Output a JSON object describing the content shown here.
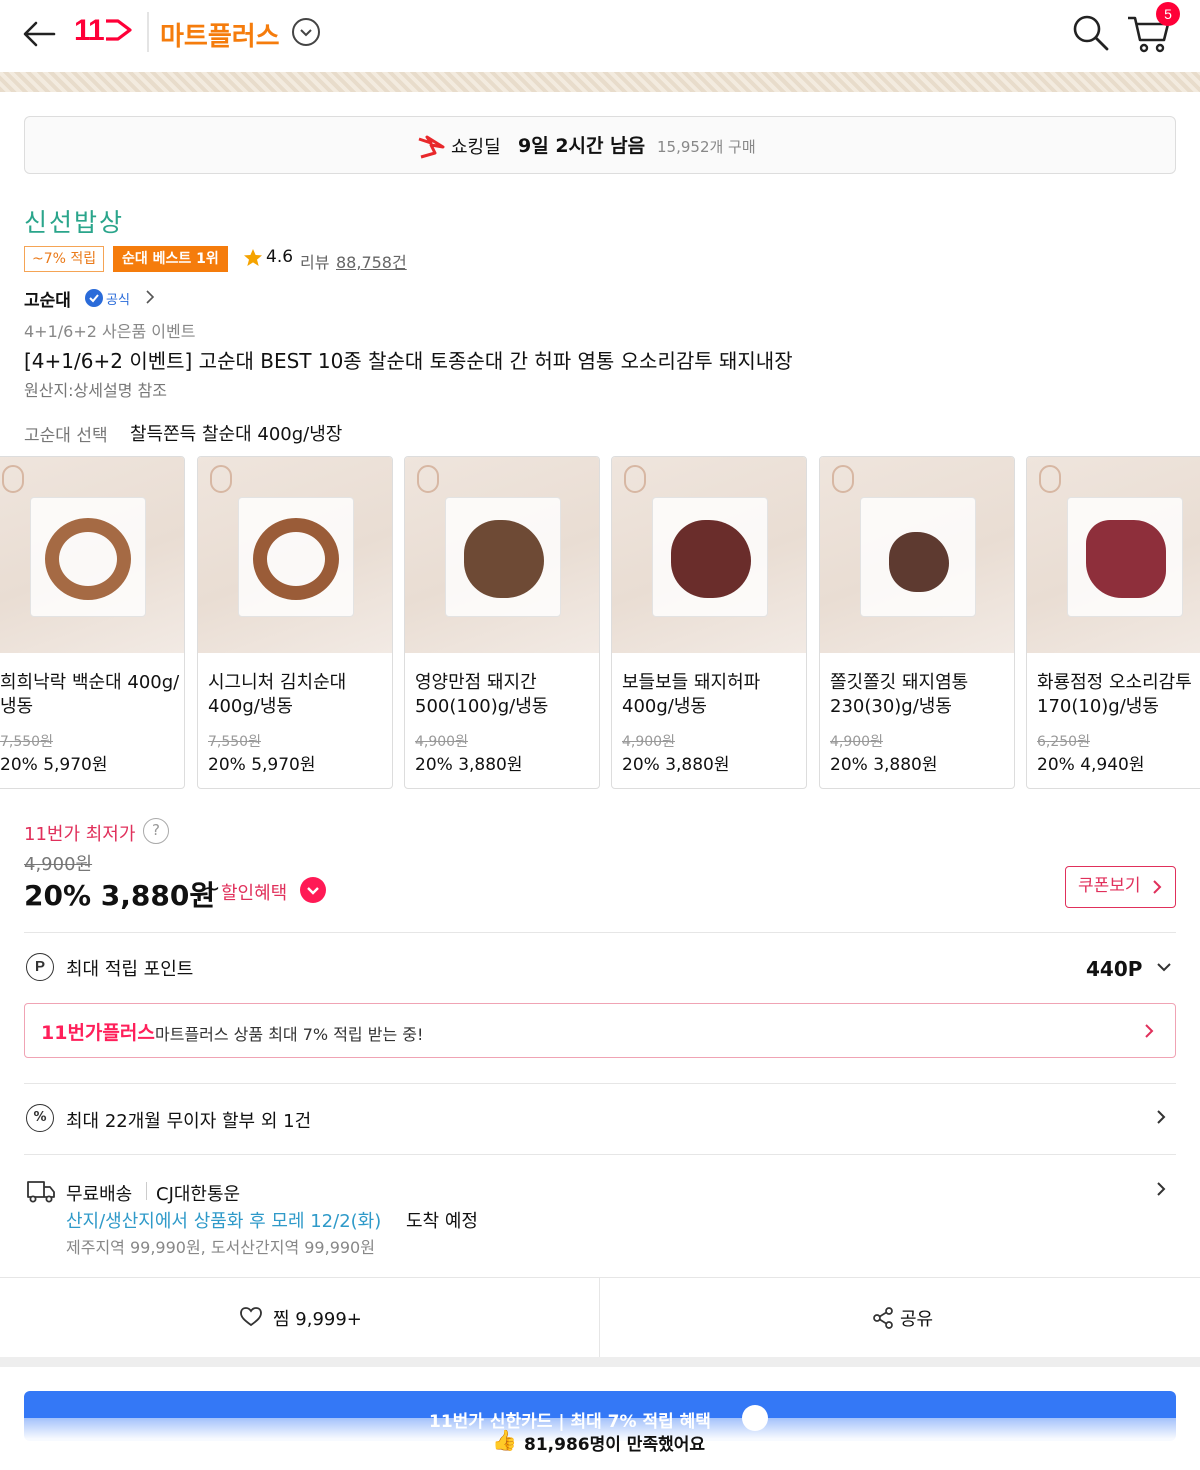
{
  "header": {
    "logo": "11",
    "store_title": "마트플러스",
    "cart_count": "5"
  },
  "deal": {
    "label": "쇼킹딜",
    "time_left": "9일 2시간 남음",
    "purchase_count": "15,952개 구매"
  },
  "product": {
    "brand": "신선밥상",
    "point_chip": "~7% 적립",
    "best_chip": "순대 베스트 1위",
    "rating": "4.6",
    "review_label": "리뷰",
    "review_count": "88,758건",
    "seller": "고순대",
    "official_label": "공식",
    "event_label": "4+1/6+2 사은품 이벤트",
    "title": "[4+1/6+2 이벤트] 고순대 BEST 10종 찰순대 토종순대 간 허파 염통 오소리감투 돼지내장",
    "origin": "원산지:상세설명 참조"
  },
  "option": {
    "label": "고순대 선택",
    "value": "찰득쫀득 찰순대 400g/냉장"
  },
  "options_carousel": [
    {
      "name": "희희낙락 백순대 400g/냉동",
      "original": "7,550원",
      "price": "20% 5,970원",
      "food": "ring",
      "color": "#a56a44"
    },
    {
      "name": "시그니처 김치순대 400g/냉동",
      "original": "7,550원",
      "price": "20% 5,970원",
      "food": "ring",
      "color": "#9a5c38"
    },
    {
      "name": "영양만점 돼지간 500(100)g/냉동",
      "original": "4,900원",
      "price": "20% 3,880원",
      "food": "blob",
      "color": "#6e4a35"
    },
    {
      "name": "보들보들 돼지허파 400g/냉동",
      "original": "4,900원",
      "price": "20% 3,880원",
      "food": "blob",
      "color": "#6a2d2b"
    },
    {
      "name": "쫄깃쫄깃 돼지염통 230(30)g/냉동",
      "original": "4,900원",
      "price": "20% 3,880원",
      "food": "blob",
      "color": "#5e3a30"
    },
    {
      "name": "화룡점정 오소리감투 170(10)g/냉동",
      "original": "6,250원",
      "price": "20% 4,940원",
      "food": "blob",
      "color": "#8e2f3b"
    }
  ],
  "price": {
    "lowest_label": "11번가 최저가",
    "help": "?",
    "original": "4,900원",
    "final": "20% 3,880원",
    "tilde": "~",
    "discount_benefit": "할인혜택",
    "coupon_button": "쿠폰보기"
  },
  "points": {
    "icon": "P",
    "label": "최대 적립 포인트",
    "value": "440P"
  },
  "plus_banner": {
    "brand": "11번가플러스",
    "text": "마트플러스 상품 최대 7% 적립 받는 중!"
  },
  "installment": {
    "icon": "%",
    "label": "최대 22개월 무이자 할부 외 1건"
  },
  "shipping": {
    "free": "무료배송",
    "carrier": "CJ대한통운",
    "eta": "산지/생산지에서 상품화 후 모레 12/2(화)",
    "arrive": "도착 예정",
    "extra": "제주지역 99,990원, 도서산간지역 99,990원"
  },
  "actions": {
    "like": "찜 9,999+",
    "share": "공유"
  },
  "card_banner": {
    "text": "11번가 신한카드 | 최대 7% 적립 혜택"
  },
  "satisfied": {
    "icon": "👍",
    "text": "81,986명이 만족했어요"
  }
}
